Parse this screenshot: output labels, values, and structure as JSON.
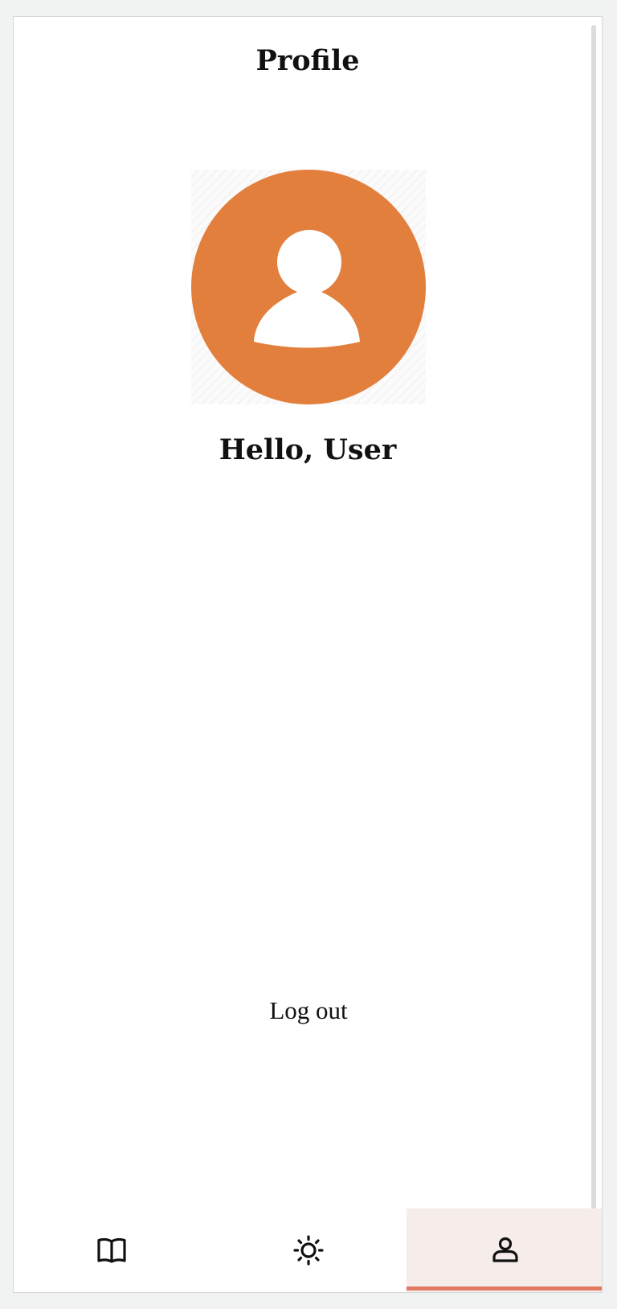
{
  "header": {
    "title": "Profile"
  },
  "profile": {
    "avatar_icon": "user-avatar-icon",
    "greeting": "Hello, User"
  },
  "actions": {
    "logout_label": "Log out"
  },
  "bottom_nav": {
    "items": [
      {
        "icon": "book-icon",
        "active": false
      },
      {
        "icon": "sun-icon",
        "active": false
      },
      {
        "icon": "user-icon",
        "active": true
      }
    ]
  },
  "colors": {
    "avatar_bg": "#e37f3d",
    "active_tab_bg": "#f6ecea",
    "active_tab_indicator": "#e07a63"
  }
}
